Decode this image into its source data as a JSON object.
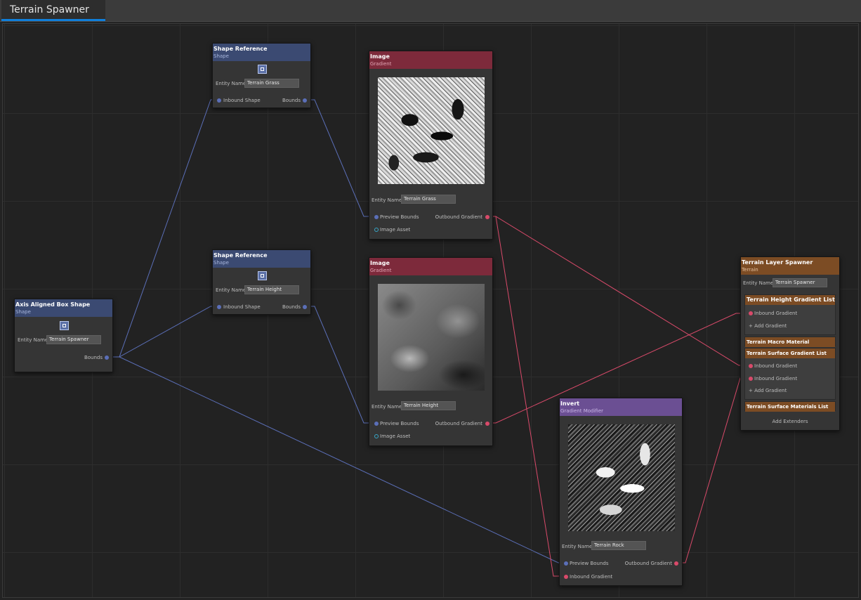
{
  "tab": {
    "label": "Terrain Spawner"
  },
  "colors": {
    "shape": "#3b4a72",
    "gradient": "#7d2a3b",
    "modifier": "#6b4f93",
    "terrain": "#7c4c24",
    "wire_blue": "#5b6fb8",
    "wire_red": "#d94a6a",
    "tab_accent": "#0f7fdb"
  },
  "nodes": {
    "aabb": {
      "title": "Axis Aligned Box Shape",
      "subtitle": "Shape",
      "icon": "box-shape-icon",
      "entity_label": "Entity Name",
      "entity_value": "Terrain Spawner",
      "out_port": "Bounds"
    },
    "shape_ref_1": {
      "title": "Shape Reference",
      "subtitle": "Shape",
      "icon": "shape-reference-icon",
      "entity_label": "Entity Name",
      "entity_value": "Terrain Grass",
      "in_port": "Inbound Shape",
      "out_port": "Bounds"
    },
    "shape_ref_2": {
      "title": "Shape Reference",
      "subtitle": "Shape",
      "icon": "shape-reference-icon",
      "entity_label": "Entity Name",
      "entity_value": "Terrain Height",
      "in_port": "Inbound Shape",
      "out_port": "Bounds"
    },
    "image_1": {
      "title": "Image",
      "subtitle": "Gradient",
      "entity_label": "Entity Name",
      "entity_value": "Terrain Grass",
      "in_port": "Preview Bounds",
      "out_port": "Outbound Gradient",
      "asset_port": "Image Asset"
    },
    "image_2": {
      "title": "Image",
      "subtitle": "Gradient",
      "entity_label": "Entity Name",
      "entity_value": "Terrain Height",
      "in_port": "Preview Bounds",
      "out_port": "Outbound Gradient",
      "asset_port": "Image Asset"
    },
    "invert": {
      "title": "Invert",
      "subtitle": "Gradient Modifier",
      "entity_label": "Entity Name",
      "entity_value": "Terrain Rock",
      "in_port": "Preview Bounds",
      "out_port": "Outbound Gradient",
      "in_port_2": "Inbound Gradient"
    },
    "spawner": {
      "title": "Terrain Layer Spawner",
      "subtitle": "Terrain",
      "entity_label": "Entity Name",
      "entity_value": "Terrain Spawner",
      "height_list": {
        "title": "Terrain Height Gradient List",
        "port": "Inbound Gradient",
        "add": "+ Add Gradient"
      },
      "macro": {
        "title": "Terrain Macro Material"
      },
      "surface_list": {
        "title": "Terrain Surface Gradient List",
        "port_1": "Inbound Gradient",
        "port_2": "Inbound Gradient",
        "add": "+ Add Gradient"
      },
      "materials": {
        "title": "Terrain Surface Materials List"
      },
      "extenders": "Add Extenders"
    }
  }
}
